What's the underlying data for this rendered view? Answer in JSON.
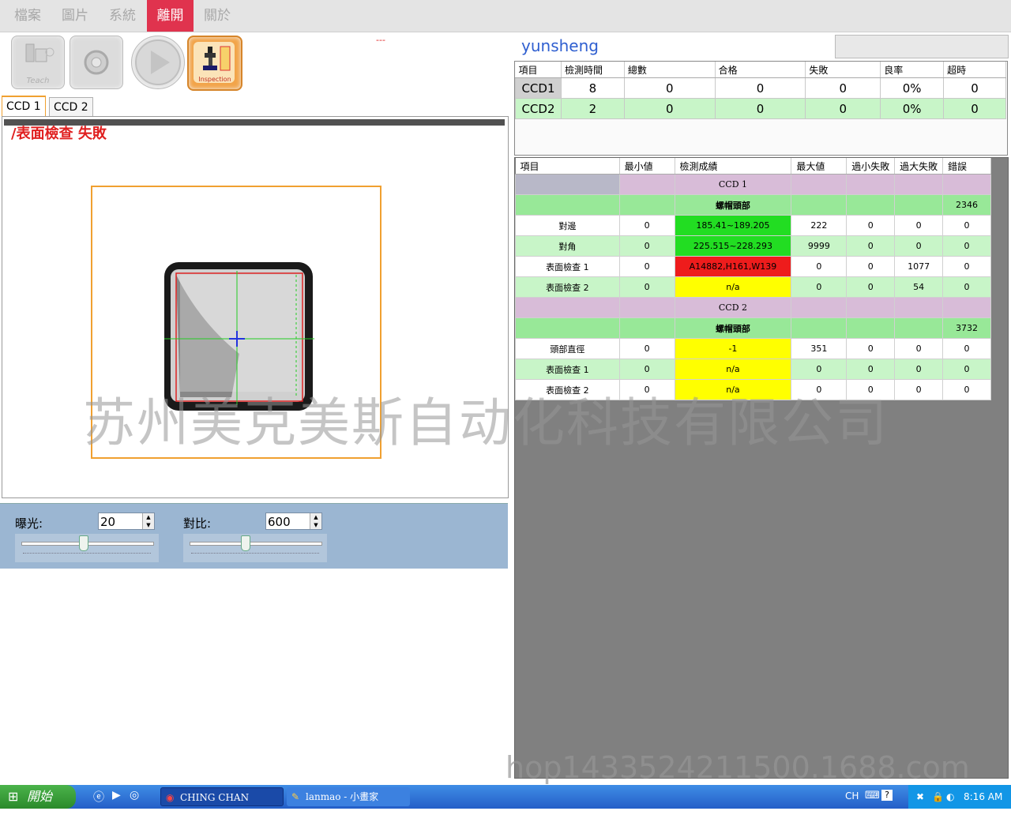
{
  "menu": [
    "檔案",
    "圖片",
    "系統",
    "離開",
    "關於"
  ],
  "menu_active_index": 3,
  "toolbar": {
    "teach": "Teach",
    "inspection": "Inspection"
  },
  "dash_text": "---",
  "tabs": [
    "CCD 1",
    "CCD 2"
  ],
  "camera": {
    "result_text": "/表面檢查 失敗"
  },
  "sliders": {
    "exposure": {
      "label": "曝光:",
      "value": "20",
      "level": 0.47
    },
    "contrast": {
      "label": "對比:",
      "value": "600",
      "level": 0.42
    }
  },
  "app_name": "yunsheng",
  "summary": {
    "headers": [
      "項目",
      "檢測時間",
      "總數",
      "合格",
      "失敗",
      "良率",
      "超時"
    ],
    "rows": [
      [
        "CCD1",
        "8",
        "0",
        "0",
        "0",
        "0%",
        "0"
      ],
      [
        "CCD2",
        "2",
        "0",
        "0",
        "0",
        "0%",
        "0"
      ]
    ]
  },
  "detail": {
    "headers": [
      "項目",
      "最小値",
      "檢測成績",
      "最大値",
      "過小失敗",
      "過大失敗",
      "錯誤"
    ],
    "ccd1": {
      "title": "CCD 1",
      "part": "螺帽頭部",
      "part_errors": "2346",
      "rows": [
        [
          "對邊",
          "0",
          "185.41~189.205",
          "222",
          "0",
          "0",
          "0"
        ],
        [
          "對角",
          "0",
          "225.515~228.293",
          "9999",
          "0",
          "0",
          "0"
        ],
        [
          "表面檢查 1",
          "0",
          "A14882,H161,W139",
          "0",
          "0",
          "1077",
          "0"
        ],
        [
          "表面檢查 2",
          "0",
          "n/a",
          "0",
          "0",
          "54",
          "0"
        ]
      ]
    },
    "ccd2": {
      "title": "CCD 2",
      "part": "螺帽頭部",
      "part_errors": "3732",
      "rows": [
        [
          "頭部直徑",
          "0",
          "-1",
          "351",
          "0",
          "0",
          "0"
        ],
        [
          "表面檢查 1",
          "0",
          "n/a",
          "0",
          "0",
          "0",
          "0"
        ],
        [
          "表面檢查 2",
          "0",
          "n/a",
          "0",
          "0",
          "0",
          "0"
        ]
      ]
    }
  },
  "watermarks": [
    "苏州美克美斯自动化科技有限公司",
    "hop1433524211500.1688.com"
  ],
  "taskbar": {
    "start": "開始",
    "tasks": [
      "CHING CHAN MAC...",
      "lanmao - 小畫家"
    ],
    "lang": "CH",
    "clock": "8:16 AM"
  },
  "colors": {
    "active_menu": "#e0334e",
    "pass": "#22dd22",
    "fail": "#ee1c1c",
    "na": "#ffff00"
  }
}
